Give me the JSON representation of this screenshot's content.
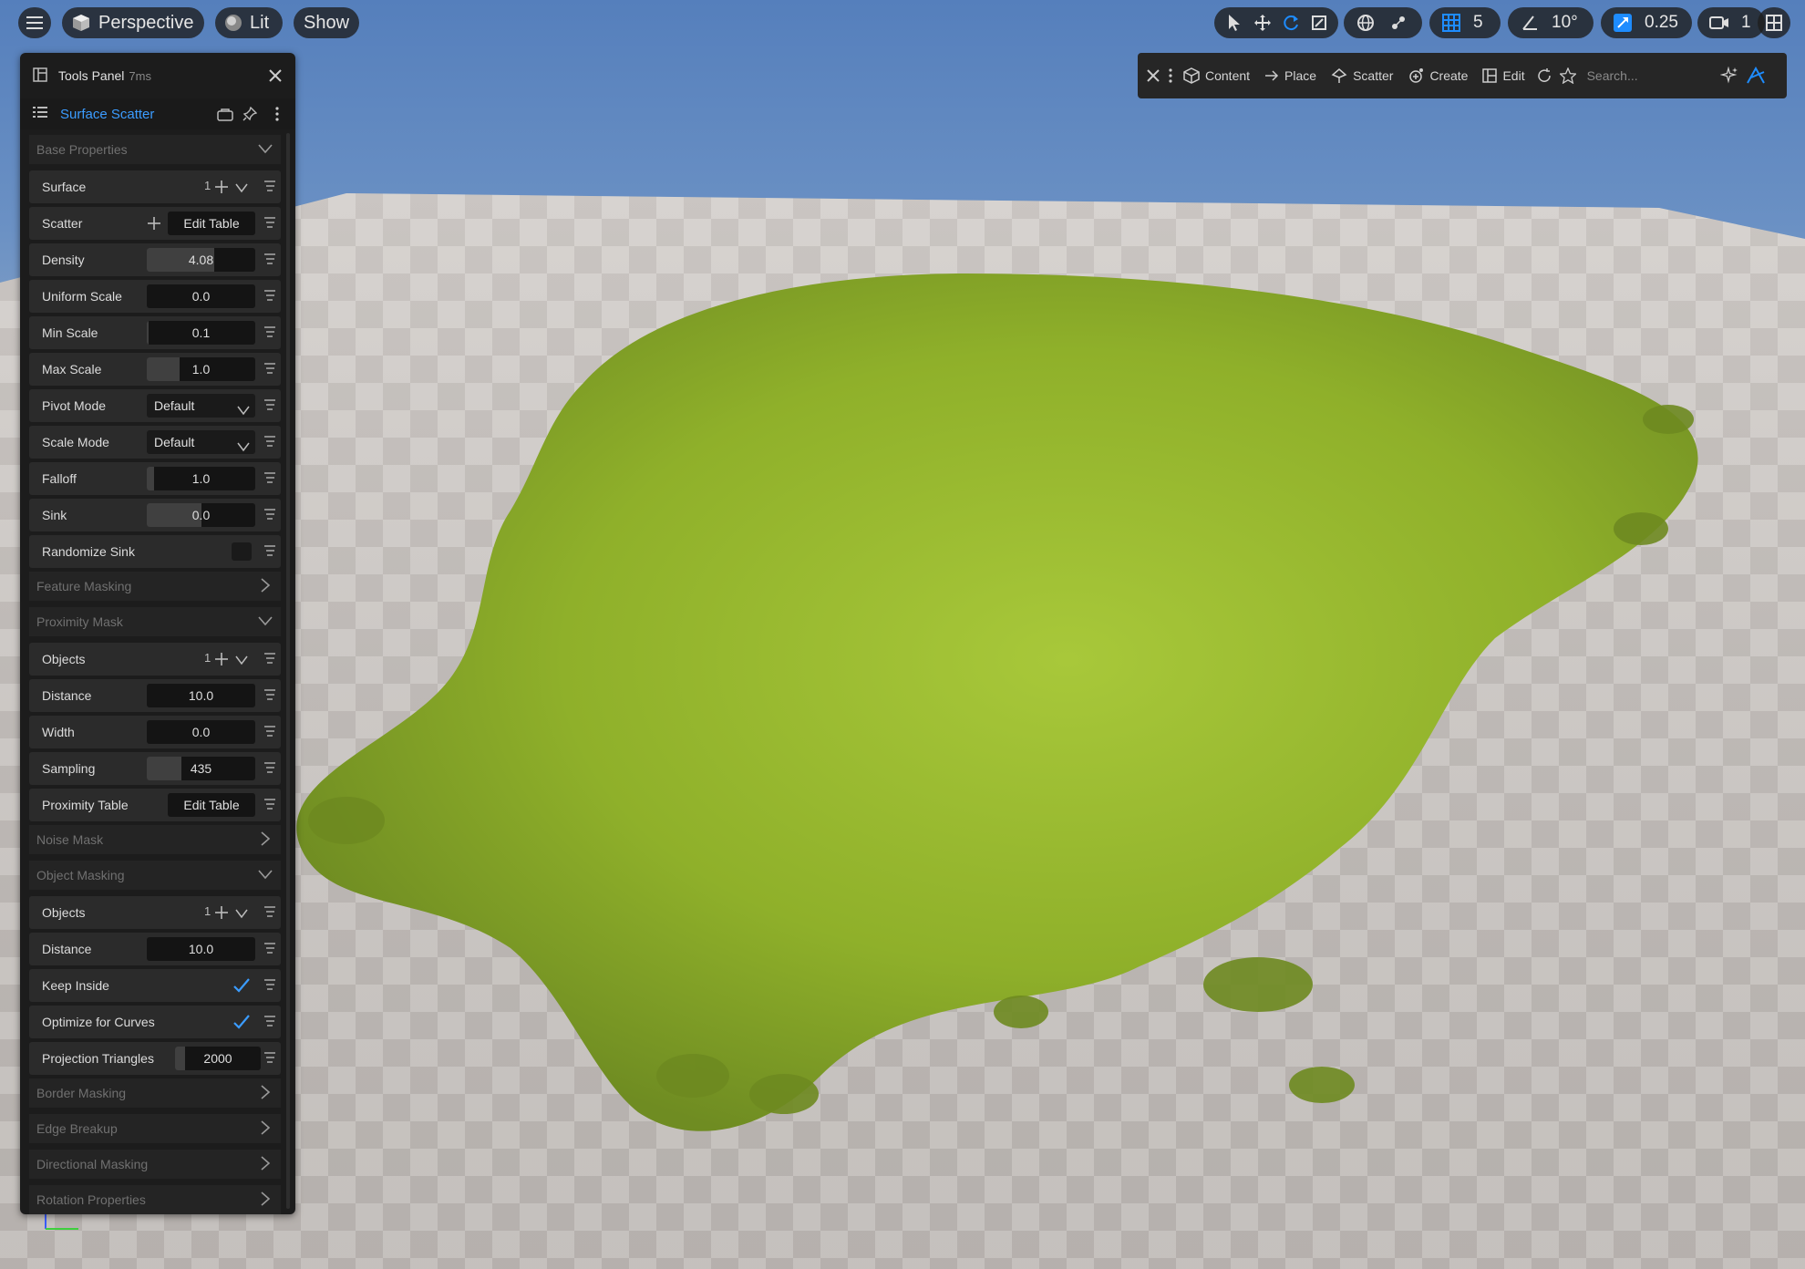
{
  "viewport": {
    "view_mode": "Perspective",
    "lighting": "Lit",
    "show": "Show",
    "grid_snap": "5",
    "angle_snap": "10°",
    "scale_snap": "0.25",
    "camera_speed": "1",
    "accent_color": "#1e8cff"
  },
  "modes": {
    "items": [
      "Content",
      "Place",
      "Scatter",
      "Create",
      "Edit"
    ],
    "search_placeholder": "Search..."
  },
  "panel": {
    "title": "Tools Panel",
    "timing": "7ms",
    "tool_name": "Surface Scatter",
    "rows": [
      {
        "type": "cat",
        "label": "Base Properties",
        "expanded": true
      },
      {
        "type": "list",
        "label": "Surface",
        "count": "1"
      },
      {
        "type": "addbtn",
        "label": "Scatter",
        "button": "Edit Table"
      },
      {
        "type": "num",
        "label": "Density",
        "value": "4.08",
        "level": 0.62
      },
      {
        "type": "num",
        "label": "Uniform Scale",
        "value": "0.0",
        "level": 0
      },
      {
        "type": "num",
        "label": "Min Scale",
        "value": "0.1",
        "level": 0.02
      },
      {
        "type": "num",
        "label": "Max Scale",
        "value": "1.0",
        "level": 0.3
      },
      {
        "type": "dd",
        "label": "Pivot Mode",
        "value": "Default"
      },
      {
        "type": "dd",
        "label": "Scale Mode",
        "value": "Default"
      },
      {
        "type": "num",
        "label": "Falloff",
        "value": "1.0",
        "level": 0.07
      },
      {
        "type": "num",
        "label": "Sink",
        "value": "0.0",
        "level": 0.5
      },
      {
        "type": "check",
        "label": "Randomize Sink",
        "checked": false
      },
      {
        "type": "cat",
        "label": "Feature Masking",
        "expanded": false
      },
      {
        "type": "cat",
        "label": "Proximity Mask",
        "expanded": true
      },
      {
        "type": "list",
        "label": "Objects",
        "count": "1"
      },
      {
        "type": "num",
        "label": "Distance",
        "value": "10.0",
        "level": 0
      },
      {
        "type": "num",
        "label": "Width",
        "value": "0.0",
        "level": 0
      },
      {
        "type": "num",
        "label": "Sampling",
        "value": "435",
        "level": 0.32
      },
      {
        "type": "btn",
        "label": "Proximity Table",
        "button": "Edit Table"
      },
      {
        "type": "cat",
        "label": "Noise Mask",
        "expanded": false
      },
      {
        "type": "cat",
        "label": "Object Masking",
        "expanded": true
      },
      {
        "type": "list",
        "label": "Objects",
        "count": "1"
      },
      {
        "type": "num",
        "label": "Distance",
        "value": "10.0",
        "level": 0
      },
      {
        "type": "check",
        "label": "Keep Inside",
        "checked": true
      },
      {
        "type": "check",
        "label": "Optimize for Curves",
        "checked": true
      },
      {
        "type": "num2",
        "label": "Projection Triangles",
        "value": "2000",
        "level": 0.12
      },
      {
        "type": "cat",
        "label": "Border Masking",
        "expanded": false
      },
      {
        "type": "cat",
        "label": "Edge Breakup",
        "expanded": false
      },
      {
        "type": "cat",
        "label": "Directional Masking",
        "expanded": false
      },
      {
        "type": "cat",
        "label": "Rotation Properties",
        "expanded": false
      }
    ]
  }
}
